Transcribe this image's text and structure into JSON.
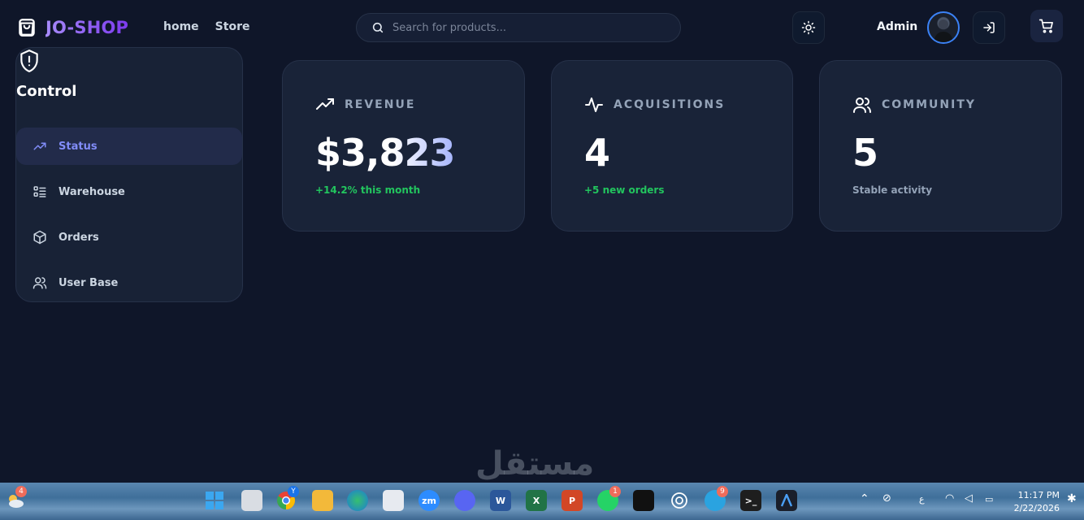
{
  "header": {
    "brand": "JO-SHOP",
    "nav": [
      "home",
      "Store"
    ],
    "search_placeholder": "Search for products...",
    "admin_name": "Admin"
  },
  "sidebar": {
    "title": "Control",
    "items": [
      {
        "label": "Status",
        "icon": "trending-up-icon",
        "active": true
      },
      {
        "label": "Warehouse",
        "icon": "list-icon",
        "active": false
      },
      {
        "label": "Orders",
        "icon": "package-icon",
        "active": false
      },
      {
        "label": "User Base",
        "icon": "users-icon",
        "active": false
      }
    ]
  },
  "cards": [
    {
      "label": "REVENUE",
      "icon": "trending-up-icon",
      "value": "$3,823",
      "sub": "+14.2% this month"
    },
    {
      "label": "ACQUISITIONS",
      "icon": "activity-icon",
      "value": "4",
      "sub": "+5 new orders"
    },
    {
      "label": "COMMUNITY",
      "icon": "users-icon",
      "value": "5",
      "sub": "Stable activity"
    }
  ],
  "colors": {
    "accent": "#818cf8",
    "brand": "#8b5cf6",
    "positive": "#22c55e",
    "background": "#0f1629"
  },
  "watermark": "مستقل",
  "taskbar": {
    "weather_badge": "4",
    "chrome_badge": "Y",
    "whatsapp_badge": "1",
    "telegram_badge": "9",
    "lang": "ع",
    "time": "11:17 PM",
    "date": "2/22/2026"
  }
}
